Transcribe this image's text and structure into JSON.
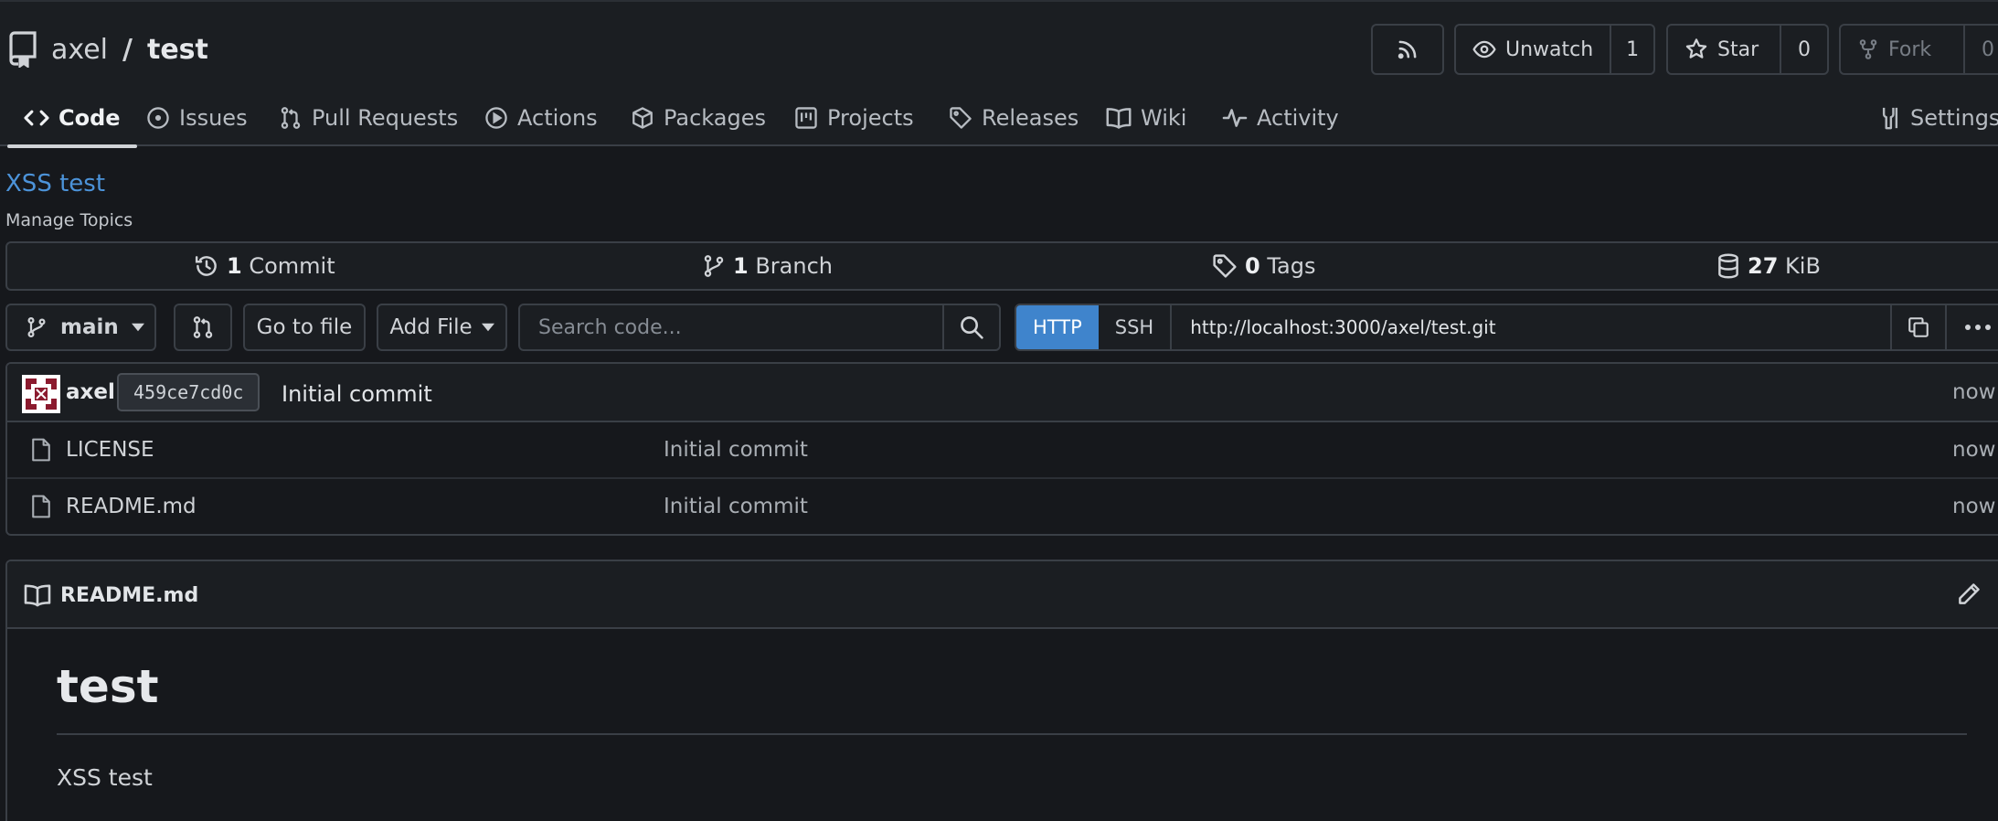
{
  "repo": {
    "owner": "axel",
    "separator": "/",
    "name": "test"
  },
  "header_buttons": {
    "watch_label": "Unwatch",
    "watch_count": "1",
    "star_label": "Star",
    "star_count": "0",
    "fork_label": "Fork",
    "fork_count": "0"
  },
  "tabs": [
    {
      "label": "Code",
      "icon": "code-icon"
    },
    {
      "label": "Issues",
      "icon": "issue-icon"
    },
    {
      "label": "Pull Requests",
      "icon": "pull-request-icon"
    },
    {
      "label": "Actions",
      "icon": "play-icon"
    },
    {
      "label": "Packages",
      "icon": "package-icon"
    },
    {
      "label": "Projects",
      "icon": "project-icon"
    },
    {
      "label": "Releases",
      "icon": "tag-icon"
    },
    {
      "label": "Wiki",
      "icon": "book-icon"
    },
    {
      "label": "Activity",
      "icon": "pulse-icon"
    },
    {
      "label": "Settings",
      "icon": "tools-icon"
    }
  ],
  "description": "XSS test",
  "manage_topics": "Manage Topics",
  "stats": {
    "commits_num": "1",
    "commits_label": "Commit",
    "branches_num": "1",
    "branches_label": "Branch",
    "tags_num": "0",
    "tags_label": "Tags",
    "size_num": "27",
    "size_label": "KiB"
  },
  "toolbar": {
    "branch": "main",
    "go_to_file": "Go to file",
    "add_file": "Add File",
    "search_placeholder": "Search code...",
    "http": "HTTP",
    "ssh": "SSH",
    "clone_url": "http://localhost:3000/axel/test.git"
  },
  "latest_commit": {
    "author": "axel",
    "sha": "459ce7cd0c",
    "message": "Initial commit",
    "time": "now"
  },
  "files": [
    {
      "name": "LICENSE",
      "message": "Initial commit",
      "time": "now"
    },
    {
      "name": "README.md",
      "message": "Initial commit",
      "time": "now"
    }
  ],
  "readme": {
    "filename": "README.md",
    "heading": "test",
    "body": "XSS test"
  },
  "colors": {
    "accent": "#3f84cc",
    "link": "#4c93d9",
    "background": "#16181c",
    "avatar": "#8b1a2e"
  }
}
